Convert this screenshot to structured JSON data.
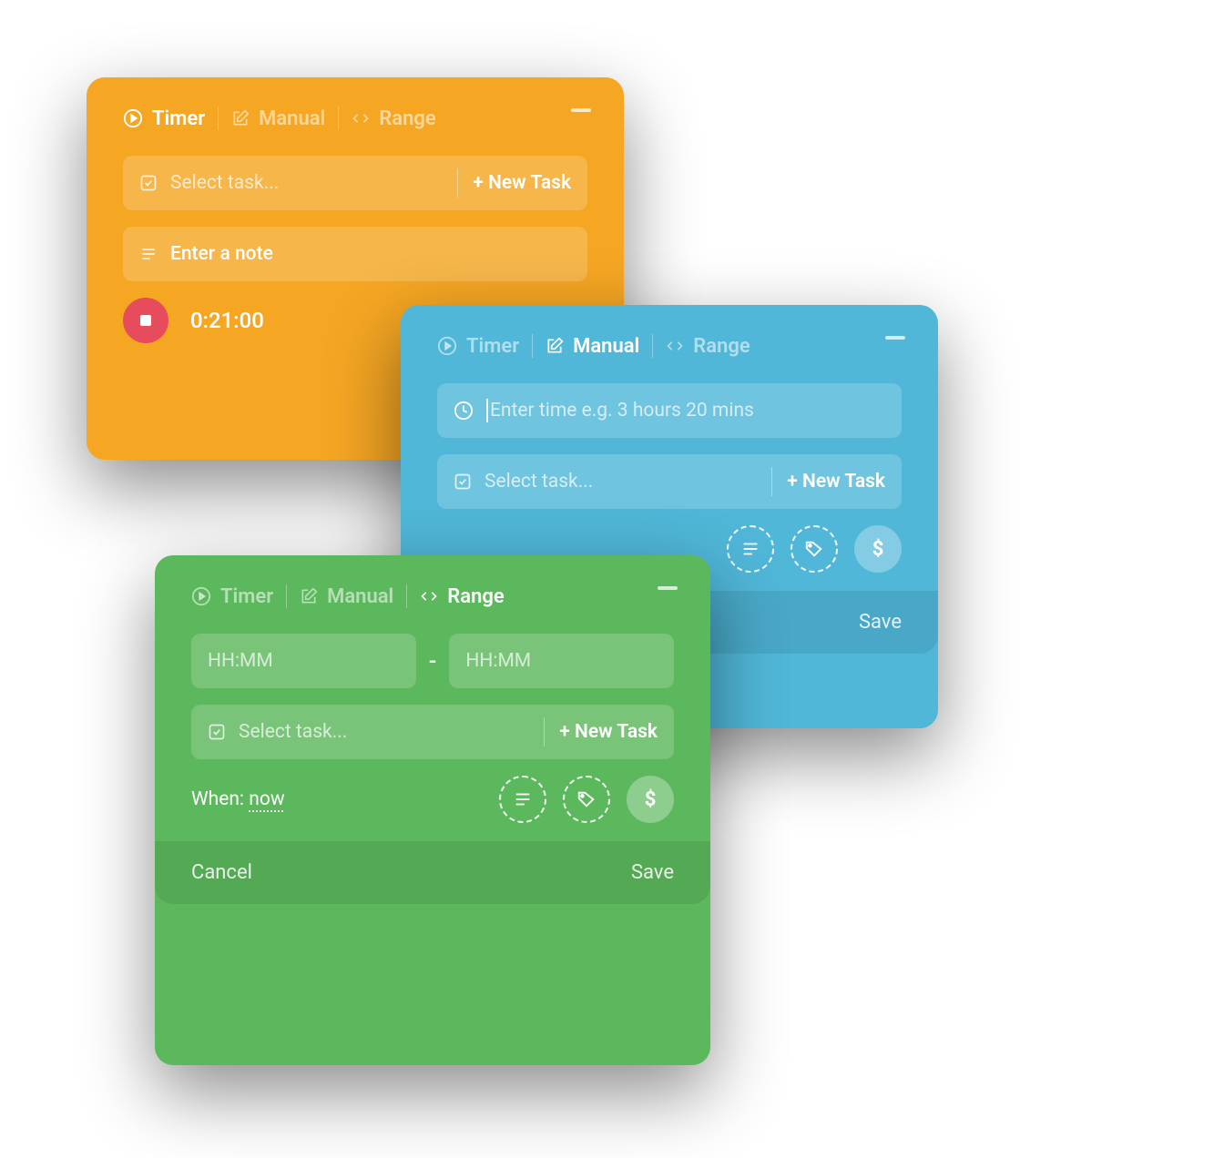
{
  "tabs": {
    "timer": "Timer",
    "manual": "Manual",
    "range": "Range"
  },
  "common": {
    "select_task": "Select task...",
    "new_task": "+ New Task",
    "cancel": "Cancel",
    "save": "Save"
  },
  "orange": {
    "note_placeholder": "Enter a note",
    "elapsed": "0:21:00"
  },
  "blue": {
    "time_placeholder": "Enter time e.g. 3 hours 20 mins"
  },
  "green": {
    "hhmm": "HH:MM",
    "when_label": "When:",
    "when_value": "now"
  },
  "icons": {
    "dollar": "$"
  }
}
